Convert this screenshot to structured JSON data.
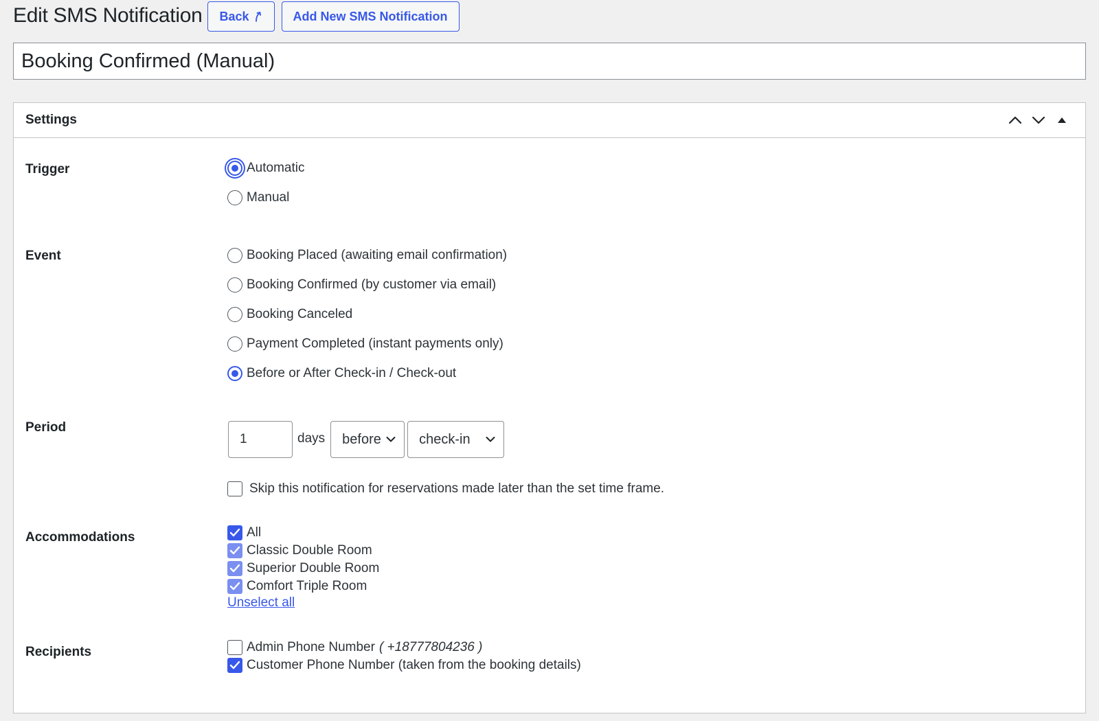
{
  "header": {
    "title": "Edit SMS Notification",
    "back_label": "Back",
    "add_new_label": "Add New SMS Notification"
  },
  "title_input": {
    "value": "Booking Confirmed (Manual)"
  },
  "settings": {
    "title": "Settings",
    "trigger": {
      "label": "Trigger",
      "options": [
        {
          "label": "Automatic",
          "selected": true
        },
        {
          "label": "Manual",
          "selected": false
        }
      ]
    },
    "event": {
      "label": "Event",
      "options": [
        {
          "label": "Booking Placed (awaiting email confirmation)",
          "selected": false
        },
        {
          "label": "Booking Confirmed (by customer via email)",
          "selected": false
        },
        {
          "label": "Booking Canceled",
          "selected": false
        },
        {
          "label": "Payment Completed (instant payments only)",
          "selected": false
        },
        {
          "label": "Before or After Check-in / Check-out",
          "selected": true
        }
      ]
    },
    "period": {
      "label": "Period",
      "value": "1",
      "unit": "days",
      "relation": "before",
      "anchor": "check-in",
      "skip_label": "Skip this notification for reservations made later than the set time frame."
    },
    "accommodations": {
      "label": "Accommodations",
      "items": [
        {
          "label": "All",
          "checked": true
        },
        {
          "label": "Classic Double Room",
          "checked": true
        },
        {
          "label": "Superior Double Room",
          "checked": true
        },
        {
          "label": "Comfort Triple Room",
          "checked": true
        }
      ],
      "unselect_all": "Unselect all"
    },
    "recipients": {
      "label": "Recipients",
      "admin_label": "Admin Phone Number",
      "admin_number": "( +18777804236 )",
      "customer_label": "Customer Phone Number (taken from the booking details)"
    }
  },
  "colors": {
    "accent": "#3858e9",
    "background": "#f0f0f1",
    "panel": "#ffffff"
  }
}
